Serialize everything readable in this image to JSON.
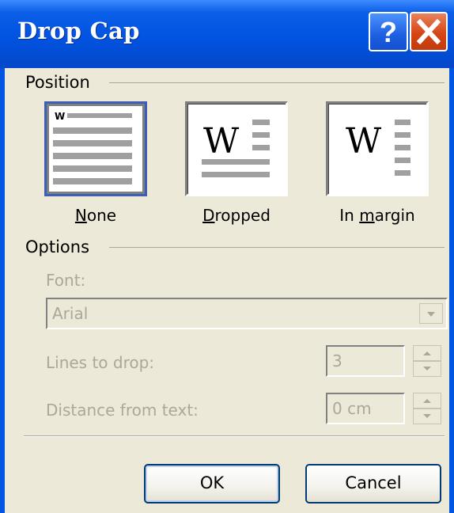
{
  "window": {
    "title": "Drop Cap"
  },
  "titlebar": {
    "help_icon": "question-icon",
    "close_icon": "close-icon"
  },
  "position": {
    "label": "Position",
    "options": [
      {
        "id": "none",
        "label_pre": "",
        "label_key": "N",
        "label_post": "one",
        "selected": true,
        "preview_letter": "W"
      },
      {
        "id": "dropped",
        "label_pre": "",
        "label_key": "D",
        "label_post": "ropped",
        "selected": false,
        "preview_letter": "W"
      },
      {
        "id": "in-margin",
        "label_pre": "In ",
        "label_key": "m",
        "label_post": "argin",
        "selected": false,
        "preview_letter": "W"
      }
    ]
  },
  "options": {
    "label": "Options",
    "font": {
      "label": "Font:",
      "value": "Arial",
      "enabled": false
    },
    "lines_to_drop": {
      "label": "Lines to drop:",
      "value": "3",
      "enabled": false
    },
    "distance": {
      "label": "Distance from text:",
      "value": "0 cm",
      "enabled": false
    }
  },
  "buttons": {
    "ok": "OK",
    "cancel": "Cancel"
  },
  "colors": {
    "title_bar": "#0153e1",
    "dialog_bg": "#ece9d8",
    "disabled_text": "#aca899",
    "close_button": "#d64514"
  }
}
